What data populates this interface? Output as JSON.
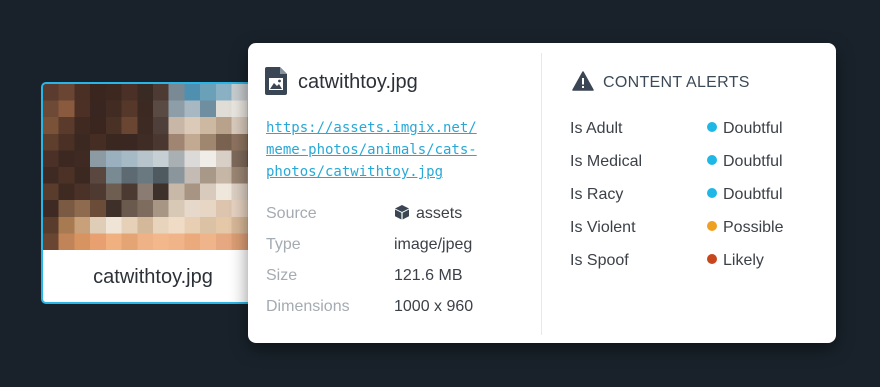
{
  "thumbnail": {
    "caption": "catwithtoy.jpg",
    "image_description_icon": "pixelated-cat-photo"
  },
  "details": {
    "file_icon": "image-file-icon",
    "filename": "catwithtoy.jpg",
    "url_lines": [
      "https://assets.imgix.net/",
      "meme-photos/animals/cats-",
      "photos/catwithtoy.jpg"
    ],
    "meta": [
      {
        "label": "Source",
        "value": "assets",
        "icon": "box-icon"
      },
      {
        "label": "Type",
        "value": "image/jpeg"
      },
      {
        "label": "Size",
        "value": "121.6 MB"
      },
      {
        "label": "Dimensions",
        "value": "1000 x 960"
      }
    ]
  },
  "alerts": {
    "icon": "warning-icon",
    "title": "CONTENT ALERTS",
    "items": [
      {
        "label": "Is Adult",
        "value": "Doubtful",
        "color": "#1fb8e6"
      },
      {
        "label": "Is Medical",
        "value": "Doubtful",
        "color": "#1fb8e6"
      },
      {
        "label": "Is Racy",
        "value": "Doubtful",
        "color": "#1fb8e6"
      },
      {
        "label": "Is Violent",
        "value": "Possible",
        "color": "#eea020"
      },
      {
        "label": "Is Spoof",
        "value": "Likely",
        "color": "#c8461e"
      }
    ]
  },
  "colors": {
    "background": "#19222b",
    "accent": "#29b6e6",
    "link": "#29a8d6"
  }
}
